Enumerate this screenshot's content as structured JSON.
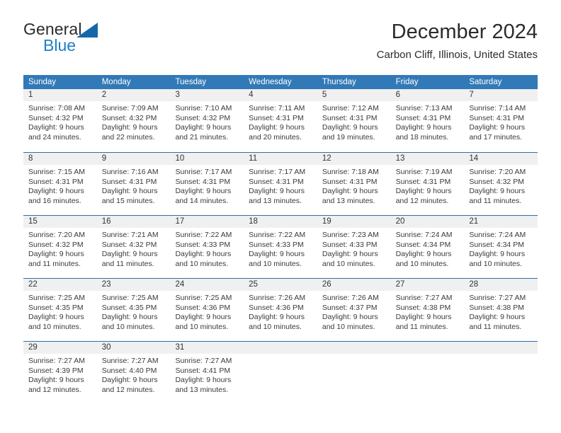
{
  "brand": {
    "line1": "General",
    "line2": "Blue",
    "mark": "triangle-logo"
  },
  "header": {
    "title": "December 2024",
    "subtitle": "Carbon Cliff, Illinois, United States"
  },
  "colors": {
    "header_blue": "#3279b7",
    "separator_blue": "#2f6fa8",
    "daynum_band": "#f0f0f0",
    "brand_blue": "#1f7fc4",
    "text": "#3a3a3a"
  },
  "calendar": {
    "weekdays": [
      "Sunday",
      "Monday",
      "Tuesday",
      "Wednesday",
      "Thursday",
      "Friday",
      "Saturday"
    ],
    "weeks": [
      [
        {
          "day": "1",
          "sunrise": "Sunrise: 7:08 AM",
          "sunset": "Sunset: 4:32 PM",
          "daylight_1": "Daylight: 9 hours",
          "daylight_2": "and 24 minutes."
        },
        {
          "day": "2",
          "sunrise": "Sunrise: 7:09 AM",
          "sunset": "Sunset: 4:32 PM",
          "daylight_1": "Daylight: 9 hours",
          "daylight_2": "and 22 minutes."
        },
        {
          "day": "3",
          "sunrise": "Sunrise: 7:10 AM",
          "sunset": "Sunset: 4:32 PM",
          "daylight_1": "Daylight: 9 hours",
          "daylight_2": "and 21 minutes."
        },
        {
          "day": "4",
          "sunrise": "Sunrise: 7:11 AM",
          "sunset": "Sunset: 4:31 PM",
          "daylight_1": "Daylight: 9 hours",
          "daylight_2": "and 20 minutes."
        },
        {
          "day": "5",
          "sunrise": "Sunrise: 7:12 AM",
          "sunset": "Sunset: 4:31 PM",
          "daylight_1": "Daylight: 9 hours",
          "daylight_2": "and 19 minutes."
        },
        {
          "day": "6",
          "sunrise": "Sunrise: 7:13 AM",
          "sunset": "Sunset: 4:31 PM",
          "daylight_1": "Daylight: 9 hours",
          "daylight_2": "and 18 minutes."
        },
        {
          "day": "7",
          "sunrise": "Sunrise: 7:14 AM",
          "sunset": "Sunset: 4:31 PM",
          "daylight_1": "Daylight: 9 hours",
          "daylight_2": "and 17 minutes."
        }
      ],
      [
        {
          "day": "8",
          "sunrise": "Sunrise: 7:15 AM",
          "sunset": "Sunset: 4:31 PM",
          "daylight_1": "Daylight: 9 hours",
          "daylight_2": "and 16 minutes."
        },
        {
          "day": "9",
          "sunrise": "Sunrise: 7:16 AM",
          "sunset": "Sunset: 4:31 PM",
          "daylight_1": "Daylight: 9 hours",
          "daylight_2": "and 15 minutes."
        },
        {
          "day": "10",
          "sunrise": "Sunrise: 7:17 AM",
          "sunset": "Sunset: 4:31 PM",
          "daylight_1": "Daylight: 9 hours",
          "daylight_2": "and 14 minutes."
        },
        {
          "day": "11",
          "sunrise": "Sunrise: 7:17 AM",
          "sunset": "Sunset: 4:31 PM",
          "daylight_1": "Daylight: 9 hours",
          "daylight_2": "and 13 minutes."
        },
        {
          "day": "12",
          "sunrise": "Sunrise: 7:18 AM",
          "sunset": "Sunset: 4:31 PM",
          "daylight_1": "Daylight: 9 hours",
          "daylight_2": "and 13 minutes."
        },
        {
          "day": "13",
          "sunrise": "Sunrise: 7:19 AM",
          "sunset": "Sunset: 4:31 PM",
          "daylight_1": "Daylight: 9 hours",
          "daylight_2": "and 12 minutes."
        },
        {
          "day": "14",
          "sunrise": "Sunrise: 7:20 AM",
          "sunset": "Sunset: 4:32 PM",
          "daylight_1": "Daylight: 9 hours",
          "daylight_2": "and 11 minutes."
        }
      ],
      [
        {
          "day": "15",
          "sunrise": "Sunrise: 7:20 AM",
          "sunset": "Sunset: 4:32 PM",
          "daylight_1": "Daylight: 9 hours",
          "daylight_2": "and 11 minutes."
        },
        {
          "day": "16",
          "sunrise": "Sunrise: 7:21 AM",
          "sunset": "Sunset: 4:32 PM",
          "daylight_1": "Daylight: 9 hours",
          "daylight_2": "and 11 minutes."
        },
        {
          "day": "17",
          "sunrise": "Sunrise: 7:22 AM",
          "sunset": "Sunset: 4:33 PM",
          "daylight_1": "Daylight: 9 hours",
          "daylight_2": "and 10 minutes."
        },
        {
          "day": "18",
          "sunrise": "Sunrise: 7:22 AM",
          "sunset": "Sunset: 4:33 PM",
          "daylight_1": "Daylight: 9 hours",
          "daylight_2": "and 10 minutes."
        },
        {
          "day": "19",
          "sunrise": "Sunrise: 7:23 AM",
          "sunset": "Sunset: 4:33 PM",
          "daylight_1": "Daylight: 9 hours",
          "daylight_2": "and 10 minutes."
        },
        {
          "day": "20",
          "sunrise": "Sunrise: 7:24 AM",
          "sunset": "Sunset: 4:34 PM",
          "daylight_1": "Daylight: 9 hours",
          "daylight_2": "and 10 minutes."
        },
        {
          "day": "21",
          "sunrise": "Sunrise: 7:24 AM",
          "sunset": "Sunset: 4:34 PM",
          "daylight_1": "Daylight: 9 hours",
          "daylight_2": "and 10 minutes."
        }
      ],
      [
        {
          "day": "22",
          "sunrise": "Sunrise: 7:25 AM",
          "sunset": "Sunset: 4:35 PM",
          "daylight_1": "Daylight: 9 hours",
          "daylight_2": "and 10 minutes."
        },
        {
          "day": "23",
          "sunrise": "Sunrise: 7:25 AM",
          "sunset": "Sunset: 4:35 PM",
          "daylight_1": "Daylight: 9 hours",
          "daylight_2": "and 10 minutes."
        },
        {
          "day": "24",
          "sunrise": "Sunrise: 7:25 AM",
          "sunset": "Sunset: 4:36 PM",
          "daylight_1": "Daylight: 9 hours",
          "daylight_2": "and 10 minutes."
        },
        {
          "day": "25",
          "sunrise": "Sunrise: 7:26 AM",
          "sunset": "Sunset: 4:36 PM",
          "daylight_1": "Daylight: 9 hours",
          "daylight_2": "and 10 minutes."
        },
        {
          "day": "26",
          "sunrise": "Sunrise: 7:26 AM",
          "sunset": "Sunset: 4:37 PM",
          "daylight_1": "Daylight: 9 hours",
          "daylight_2": "and 10 minutes."
        },
        {
          "day": "27",
          "sunrise": "Sunrise: 7:27 AM",
          "sunset": "Sunset: 4:38 PM",
          "daylight_1": "Daylight: 9 hours",
          "daylight_2": "and 11 minutes."
        },
        {
          "day": "28",
          "sunrise": "Sunrise: 7:27 AM",
          "sunset": "Sunset: 4:38 PM",
          "daylight_1": "Daylight: 9 hours",
          "daylight_2": "and 11 minutes."
        }
      ],
      [
        {
          "day": "29",
          "sunrise": "Sunrise: 7:27 AM",
          "sunset": "Sunset: 4:39 PM",
          "daylight_1": "Daylight: 9 hours",
          "daylight_2": "and 12 minutes."
        },
        {
          "day": "30",
          "sunrise": "Sunrise: 7:27 AM",
          "sunset": "Sunset: 4:40 PM",
          "daylight_1": "Daylight: 9 hours",
          "daylight_2": "and 12 minutes."
        },
        {
          "day": "31",
          "sunrise": "Sunrise: 7:27 AM",
          "sunset": "Sunset: 4:41 PM",
          "daylight_1": "Daylight: 9 hours",
          "daylight_2": "and 13 minutes."
        },
        {
          "day": "",
          "sunrise": "",
          "sunset": "",
          "daylight_1": "",
          "daylight_2": ""
        },
        {
          "day": "",
          "sunrise": "",
          "sunset": "",
          "daylight_1": "",
          "daylight_2": ""
        },
        {
          "day": "",
          "sunrise": "",
          "sunset": "",
          "daylight_1": "",
          "daylight_2": ""
        },
        {
          "day": "",
          "sunrise": "",
          "sunset": "",
          "daylight_1": "",
          "daylight_2": ""
        }
      ]
    ]
  }
}
